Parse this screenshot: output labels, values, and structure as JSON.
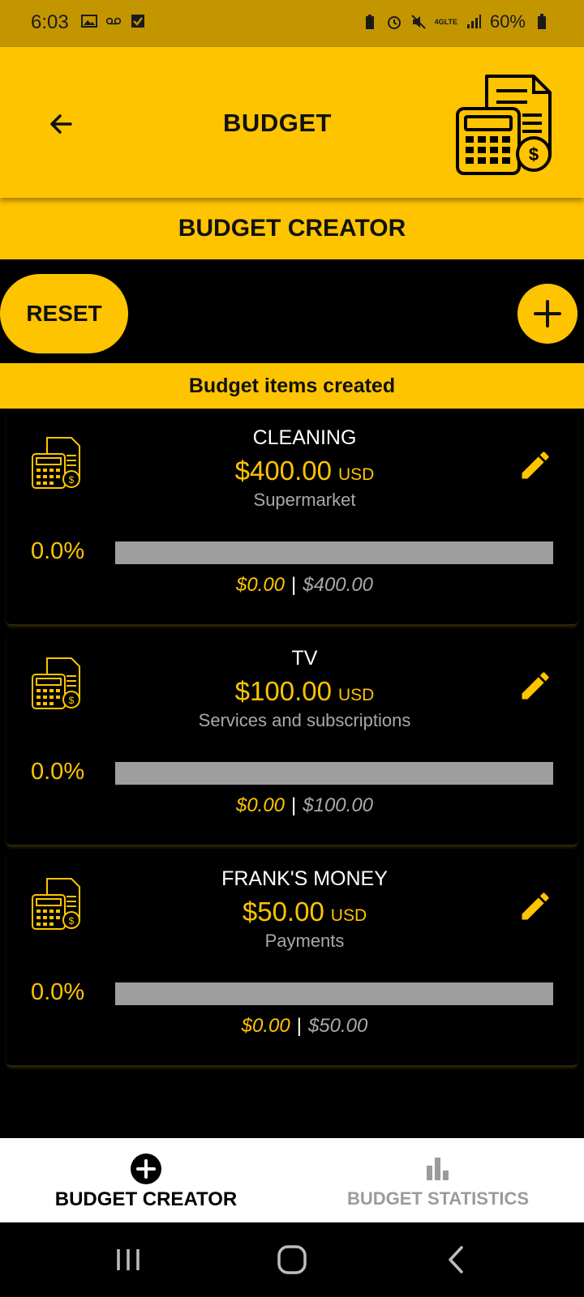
{
  "status_bar": {
    "time": "6:03",
    "battery": "60%",
    "network": "4GLTE"
  },
  "app_bar": {
    "title": "BUDGET"
  },
  "section": {
    "title": "BUDGET CREATOR"
  },
  "actions": {
    "reset_label": "RESET"
  },
  "items_header": "Budget items created",
  "budget_items": [
    {
      "name": "CLEANING",
      "amount": "$400.00",
      "currency": "USD",
      "category": "Supermarket",
      "percent": "0.0%",
      "progress": 0.0,
      "spent": "$0.00",
      "separator": "|",
      "budget": "$400.00"
    },
    {
      "name": "TV",
      "amount": "$100.00",
      "currency": "USD",
      "category": "Services and subscriptions",
      "percent": "0.0%",
      "progress": 0.0,
      "spent": "$0.00",
      "separator": "|",
      "budget": "$100.00"
    },
    {
      "name": "FRANK'S MONEY",
      "amount": "$50.00",
      "currency": "USD",
      "category": "Payments",
      "percent": "0.0%",
      "progress": 0.0,
      "spent": "$0.00",
      "separator": "|",
      "budget": "$50.00"
    }
  ],
  "bottom_nav": {
    "items": [
      {
        "label": "BUDGET CREATOR",
        "icon": "add-circle-icon",
        "active": true
      },
      {
        "label": "BUDGET STATISTICS",
        "icon": "bar-chart-icon",
        "active": false
      }
    ]
  },
  "colors": {
    "accent": "#ffc400",
    "status_bar": "#c39600",
    "background": "#000000",
    "progress_track": "#9e9e9e",
    "muted_text": "#a9a9a9"
  }
}
